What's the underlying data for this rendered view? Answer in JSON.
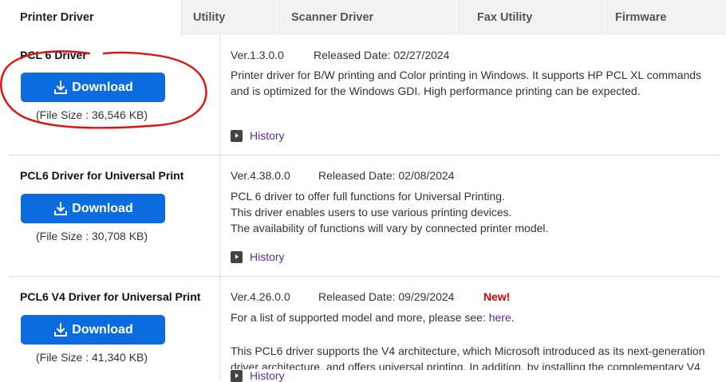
{
  "tabs": [
    {
      "label": "Printer Driver",
      "active": true
    },
    {
      "label": "Utility",
      "active": false
    },
    {
      "label": "Scanner Driver",
      "active": false
    },
    {
      "label": "Fax Utility",
      "active": false
    },
    {
      "label": "Firmware",
      "active": false
    }
  ],
  "drivers": [
    {
      "name": "PCL 6 Driver",
      "download_label": "Download",
      "file_size": "(File Size : 36,546 KB)",
      "version": "Ver.1.3.0.0",
      "released": "Released Date: 02/27/2024",
      "desc_lines": [
        "Printer driver for B/W printing and Color printing in Windows. It supports HP PCL XL commands",
        "and is optimized for the Windows GDI. High performance printing can be expected."
      ],
      "history_label": "History"
    },
    {
      "name": "PCL6 Driver for Universal Print",
      "download_label": "Download",
      "file_size": "(File Size : 30,708 KB)",
      "version": "Ver.4.38.0.0",
      "released": "Released Date: 02/08/2024",
      "desc_lines": [
        "PCL 6 driver to offer full functions for Universal Printing.",
        "This driver enables users to use various printing devices.",
        "The availability of functions will vary by connected printer model."
      ],
      "history_label": "History"
    },
    {
      "name": "PCL6 V4 Driver for Universal Print",
      "download_label": "Download",
      "file_size": "(File Size : 41,340 KB)",
      "version": "Ver.4.26.0.0",
      "released": "Released Date: 09/29/2024",
      "new_badge": "New!",
      "desc_line1_prefix": "For a list of supported model and more, please see: ",
      "desc_line1_link": "here",
      "desc_line1_suffix": ".",
      "desc_lines": [
        "This PCL6 driver supports the V4 architecture, which Microsoft introduced as its next-generation",
        "driver architecture, and offers universal printing. In addition, by installing the complementary V4"
      ],
      "history_label": "History"
    }
  ],
  "colors": {
    "download_button": "#0a6cde",
    "link": "#5a2d9c",
    "new_badge": "#e00000",
    "annotation": "#e01010"
  }
}
